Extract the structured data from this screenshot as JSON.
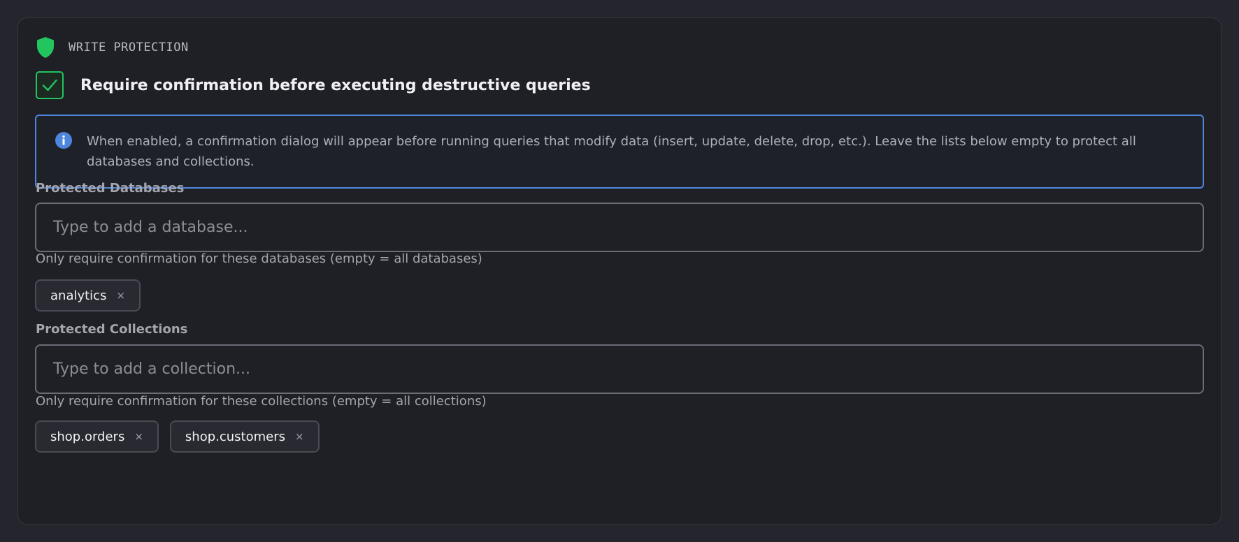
{
  "section": {
    "title": "WRITE PROTECTION",
    "icon": "shield-icon",
    "accent_color": "#22c55e"
  },
  "confirmation": {
    "checked": true,
    "label": "Require confirmation before executing destructive queries"
  },
  "info": {
    "icon": "info-icon",
    "text": "When enabled, a confirmation dialog will appear before running queries that modify data (insert, update, delete, drop, etc.). Leave the lists below empty to protect all databases and collections.",
    "border_color": "#4f86dd"
  },
  "databases": {
    "label": "Protected Databases",
    "placeholder": "Type to add a database...",
    "value": "",
    "helper": "Only require confirmation for these databases (empty = all databases)",
    "tags": [
      {
        "label": "analytics",
        "remove": "×"
      }
    ]
  },
  "collections": {
    "label": "Protected Collections",
    "placeholder": "Type to add a collection...",
    "value": "",
    "helper": "Only require confirmation for these collections (empty = all collections)",
    "tags": [
      {
        "label": "shop.orders",
        "remove": "×"
      },
      {
        "label": "shop.customers",
        "remove": "×"
      }
    ]
  }
}
